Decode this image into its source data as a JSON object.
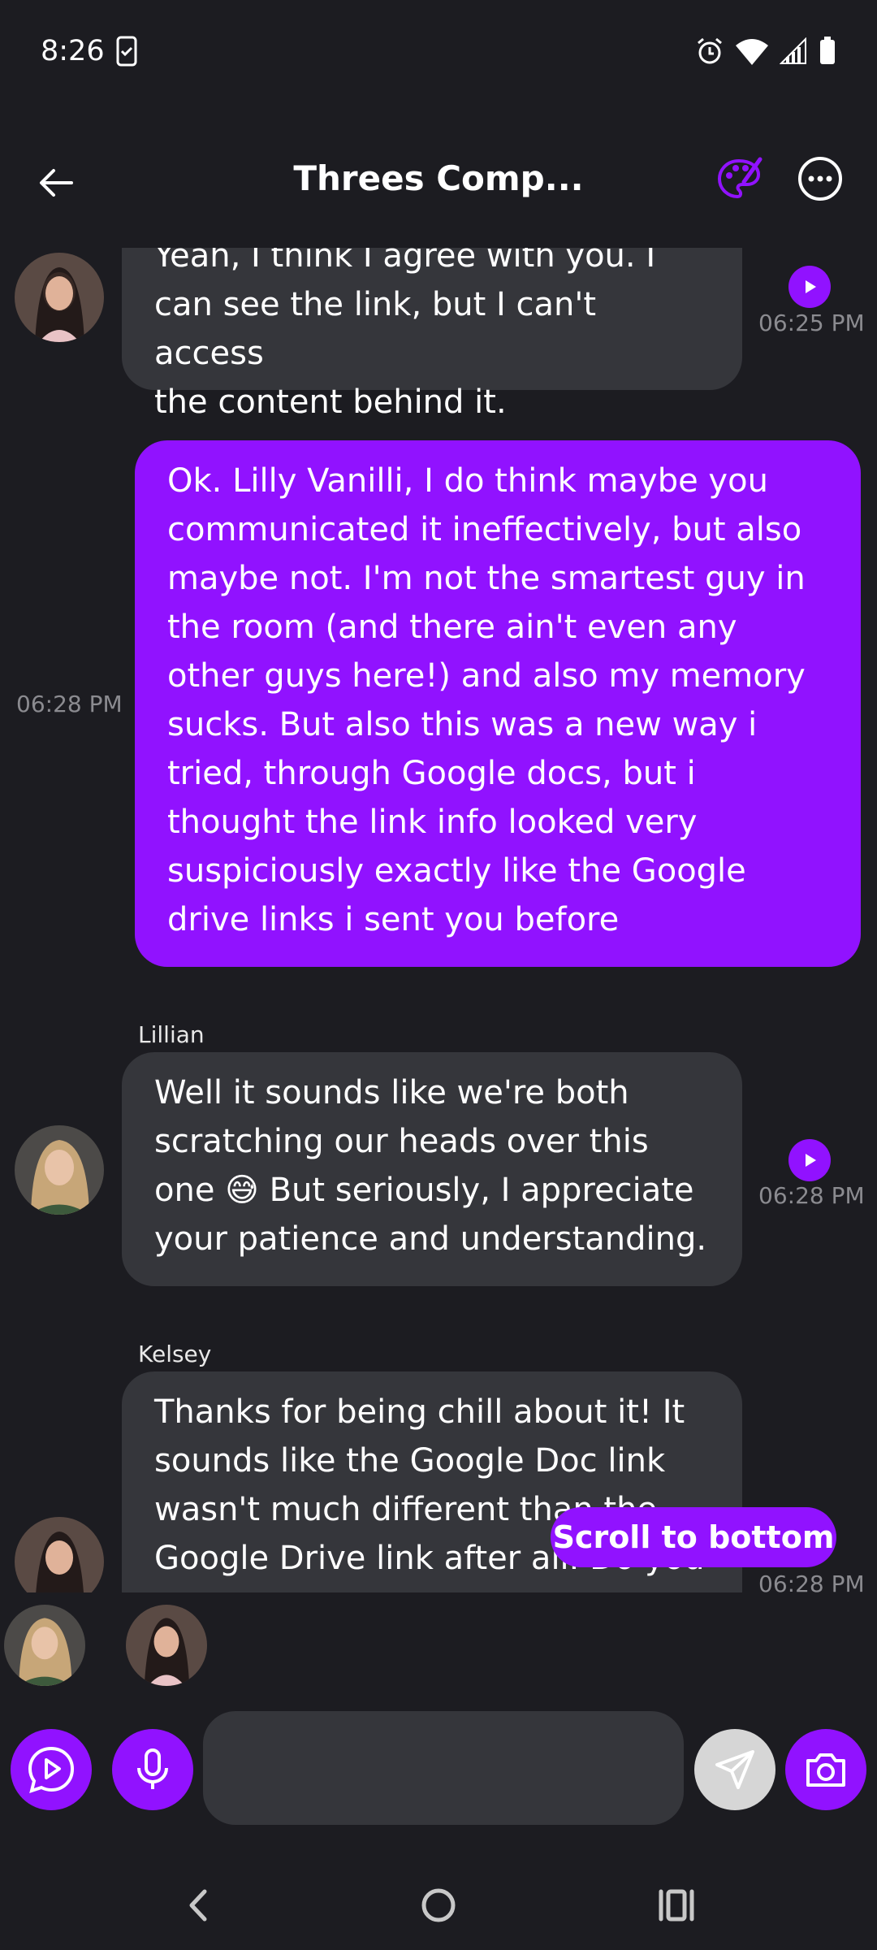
{
  "status": {
    "time": "8:26"
  },
  "header": {
    "title": "Threes Comp..."
  },
  "messages": [
    {
      "lines": [
        "Yeah, I think I agree with you. I",
        "can see the link, but I can't access",
        "the content behind it."
      ],
      "time": "06:25 PM"
    },
    {
      "lines": [
        "Ok. Lilly Vanilli, I do think maybe you",
        "communicated it ineffectively, but also",
        "maybe not. I'm not the smartest guy in",
        "the room (and there ain't even any",
        "other guys here!) and also my memory",
        "sucks. But also this was a new way i",
        "tried, through Google docs, but i",
        "thought the link info looked very",
        "suspiciously exactly like the Google",
        "drive links i sent you before"
      ],
      "time": "06:28 PM"
    },
    {
      "sender": "Lillian",
      "lines": [
        "Well it sounds like we're both",
        "scratching our heads over this",
        "one 😅 But seriously, I appreciate",
        "your patience and understanding."
      ],
      "time": "06:28 PM"
    },
    {
      "sender": "Kelsey",
      "lines": [
        "Thanks for being chill about it! It",
        "sounds like the Google Doc link",
        "wasn't much different than the",
        "Google Drive link after all. Do you"
      ],
      "time": "06:28 PM"
    }
  ],
  "scroll_to_bottom": "Scroll to bottom",
  "input": {
    "placeholder": ""
  },
  "colors": {
    "background": "#1c1c21",
    "bubble_in": "#35363b",
    "bubble_out": "#9112ff",
    "accent": "#9112ff"
  }
}
